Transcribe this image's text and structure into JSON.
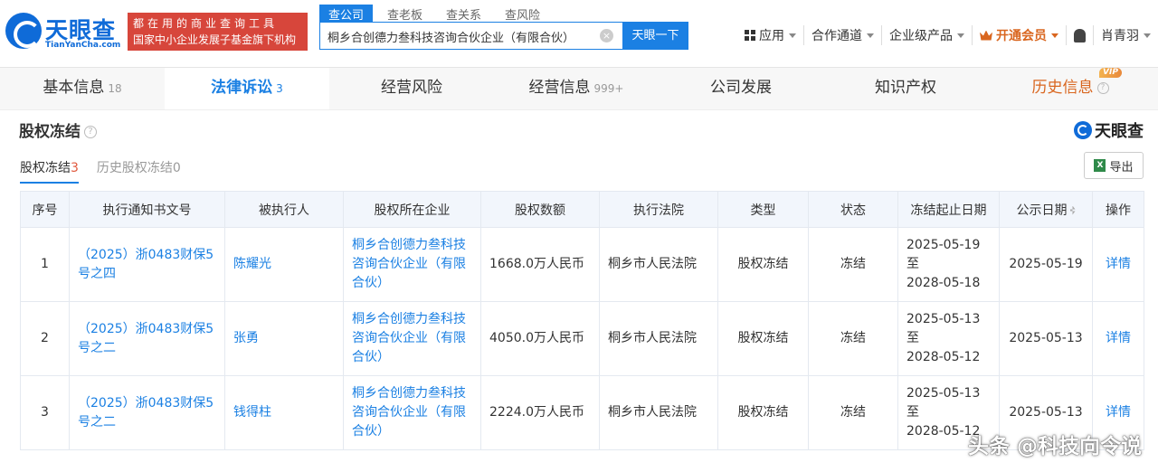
{
  "header": {
    "logo_cn": "天眼查",
    "logo_en": "TianYanCha.com",
    "slogan_line1": "都在用的商业查询工具",
    "slogan_line2": "国家中小企业发展子基金旗下机构",
    "search_tabs": [
      "查公司",
      "查老板",
      "查关系",
      "查风险"
    ],
    "search_value": "桐乡合创德力叁科技咨询合伙企业（有限合伙）",
    "search_button": "天眼一下",
    "nav": {
      "apps": "应用",
      "channel": "合作通道",
      "enterprise": "企业级产品",
      "vip": "开通会员",
      "user": "肖青羽"
    }
  },
  "tabs": [
    {
      "label": "基本信息",
      "count": "18"
    },
    {
      "label": "法律诉讼",
      "count": "3"
    },
    {
      "label": "经营风险",
      "count": ""
    },
    {
      "label": "经营信息",
      "count": "999+"
    },
    {
      "label": "公司发展",
      "count": ""
    },
    {
      "label": "知识产权",
      "count": ""
    },
    {
      "label": "历史信息",
      "count": ""
    }
  ],
  "vip_badge": "VIP",
  "section": {
    "title": "股权冻结",
    "brand": "天眼查",
    "subtabs": [
      {
        "label": "股权冻结",
        "count": "3"
      },
      {
        "label": "历史股权冻结",
        "count": "0"
      }
    ],
    "export": "导出",
    "excel_icon_letter": "X"
  },
  "table": {
    "columns": [
      "序号",
      "执行通知书文号",
      "被执行人",
      "股权所在企业",
      "股权数额",
      "执行法院",
      "类型",
      "状态",
      "冻结起止日期",
      "公示日期",
      "操作"
    ],
    "rows": [
      {
        "no": "1",
        "doc": "（2025）浙0483财保5号之四",
        "person": "陈耀光",
        "company": "桐乡合创德力叁科技咨询合伙企业（有限合伙）",
        "amount": "1668.0万人民币",
        "court": "桐乡市人民法院",
        "type": "股权冻结",
        "status": "冻结",
        "start": "2025-05-19 至",
        "end": "2028-05-18",
        "pub": "2025-05-19",
        "action": "详情"
      },
      {
        "no": "2",
        "doc": "（2025）浙0483财保5号之二",
        "person": "张勇",
        "company": "桐乡合创德力叁科技咨询合伙企业（有限合伙）",
        "amount": "4050.0万人民币",
        "court": "桐乡市人民法院",
        "type": "股权冻结",
        "status": "冻结",
        "start": "2025-05-13 至",
        "end": "2028-05-12",
        "pub": "2025-05-13",
        "action": "详情"
      },
      {
        "no": "3",
        "doc": "（2025）浙0483财保5号之二",
        "person": "钱得柱",
        "company": "桐乡合创德力叁科技咨询合伙企业（有限合伙）",
        "amount": "2224.0万人民币",
        "court": "桐乡市人民法院",
        "type": "股权冻结",
        "status": "冻结",
        "start": "2025-05-13 至",
        "end": "2028-05-12",
        "pub": "2025-05-13",
        "action": "详情"
      }
    ]
  },
  "watermark": "头条 @科技向令说"
}
